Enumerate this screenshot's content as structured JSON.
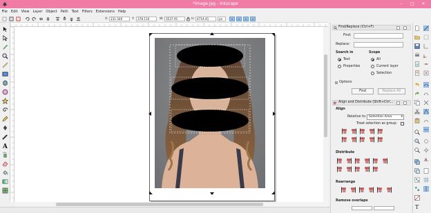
{
  "window": {
    "title": "*image.jpg - Inkscape",
    "minimize": "–",
    "maximize": "□",
    "close": "✕"
  },
  "menu": [
    "File",
    "Edit",
    "View",
    "Layer",
    "Object",
    "Path",
    "Text",
    "Filters",
    "Extensions",
    "Help"
  ],
  "toolbar": {
    "x_label": "X:",
    "x_value": "231.540",
    "y_label": "Y:",
    "y_value": "378.110",
    "w_label": "W:",
    "w_value": "3537.91",
    "h_label": "H:",
    "h_value": "4714.41",
    "unit": "px"
  },
  "find_replace": {
    "title": "Find/Replace (Ctrl+F)",
    "find_label": "Find:",
    "find_value": "",
    "replace_label": "Replace:",
    "replace_value": "",
    "search_in_label": "Search in",
    "opt_text": "Text",
    "opt_properties": "Properties",
    "scope_label": "Scope",
    "scope_all": "All",
    "scope_current_layer": "Current layer",
    "scope_selection": "Selection",
    "options_label": "Options",
    "find_button": "Find",
    "replace_all_button": "Replace All"
  },
  "align": {
    "title": "Align and Distribute (Shift+Ctrl...",
    "align_label": "Align",
    "relative_to_label": "Relative to:",
    "relative_to_value": "Selection Area",
    "treat_as_group": "Treat selection as group:",
    "distribute_label": "Distribute",
    "rearrange_label": "Rearrange",
    "remove_overlaps_label": "Remove overlaps"
  },
  "colors": {
    "titlebar": "#f07ca6",
    "accent": "#3c7fc4"
  }
}
